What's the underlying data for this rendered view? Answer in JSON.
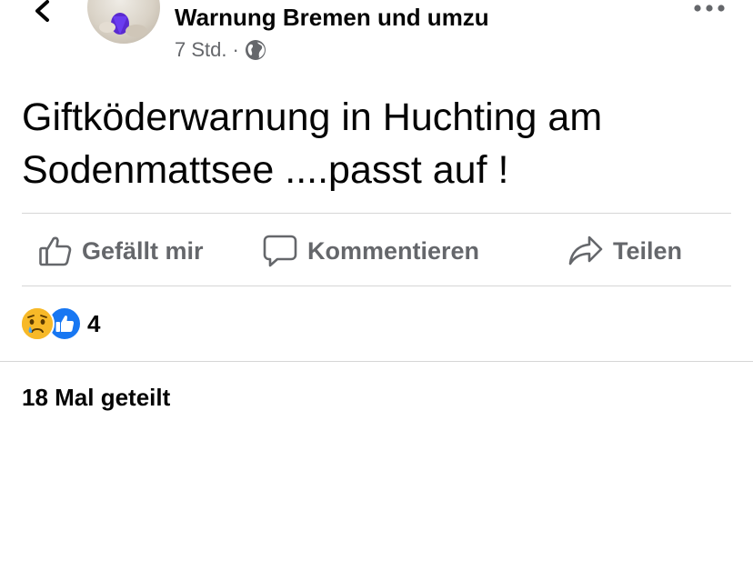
{
  "post": {
    "author": "Warnung Bremen und umzu",
    "time": "7 Std.",
    "separator": "·",
    "audience_icon": "globe-icon",
    "text_line1": "Giftköderwarnung in Huchting am",
    "text_line2": "Sodenmattsee ....passt auf !"
  },
  "actions": {
    "like_label": "Gefällt mir",
    "comment_label": "Kommentieren",
    "share_label": "Teilen"
  },
  "reactions": {
    "icons": [
      "sad-reaction-icon",
      "like-reaction-icon"
    ],
    "count": "4"
  },
  "shares": {
    "label": "18 Mal geteilt"
  },
  "colors": {
    "text": "#050505",
    "secondary": "#65676b",
    "like_blue": "#1877f2",
    "sad_yellow": "#f7b928",
    "divider": "#d6d6d6"
  }
}
